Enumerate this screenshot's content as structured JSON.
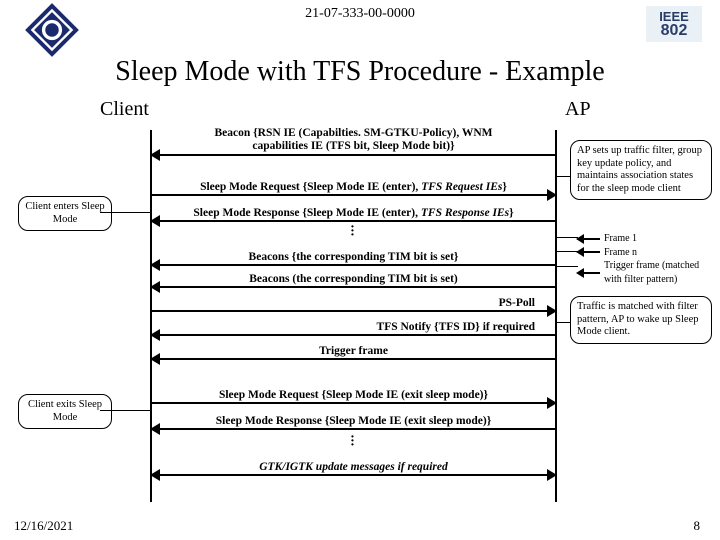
{
  "doc_number": "21-07-333-00-0000",
  "ieee": {
    "top": "IEEE",
    "bottom": "802"
  },
  "title": "Sleep Mode with TFS Procedure - Example",
  "labels": {
    "client": "Client",
    "ap": "AP"
  },
  "notes": {
    "enter_note": "Client enters Sleep Mode",
    "exit_note": "Client exits Sleep Mode",
    "ap_filter_note": "AP sets up traffic filter, group key update policy, and maintains association states for the sleep mode client",
    "traffic_match_note": "Traffic is matched with filter pattern, AP to wake up Sleep Mode client."
  },
  "legend": {
    "frame1": "Frame 1",
    "framen": "Frame n",
    "trigger": "Trigger frame (matched with filter pattern)"
  },
  "messages": {
    "beacon_caps_a": "Beacon {RSN IE (Capabilties. SM-GTKU-Policy), WNM",
    "beacon_caps_b": "capabilities IE (TFS bit, Sleep Mode bit)}",
    "sm_req_enter_a": "Sleep Mode Request {Sleep Mode IE (enter), ",
    "sm_req_enter_b": "TFS Request IEs",
    "sm_req_enter_c": "}",
    "sm_resp_enter_a": "Sleep Mode Response {Sleep Mode IE (enter), ",
    "sm_resp_enter_b": "TFS Response IEs",
    "sm_resp_enter_c": "}",
    "beacons_tim_1": "Beacons {the corresponding TIM bit is set}",
    "beacons_tim_2": "Beacons (the corresponding TIM bit is set)",
    "ps_poll": "PS-Poll",
    "tfs_notify": "TFS Notify {TFS ID} if required",
    "trigger_frame": "Trigger frame",
    "sm_req_exit": "Sleep Mode Request {Sleep Mode IE (exit sleep mode)}",
    "sm_resp_exit": "Sleep Mode Response {Sleep Mode IE (exit sleep mode)}",
    "gtk_update": "GTK/IGTK update messages if required"
  },
  "footer": {
    "date": "12/16/2021",
    "page": "8"
  }
}
